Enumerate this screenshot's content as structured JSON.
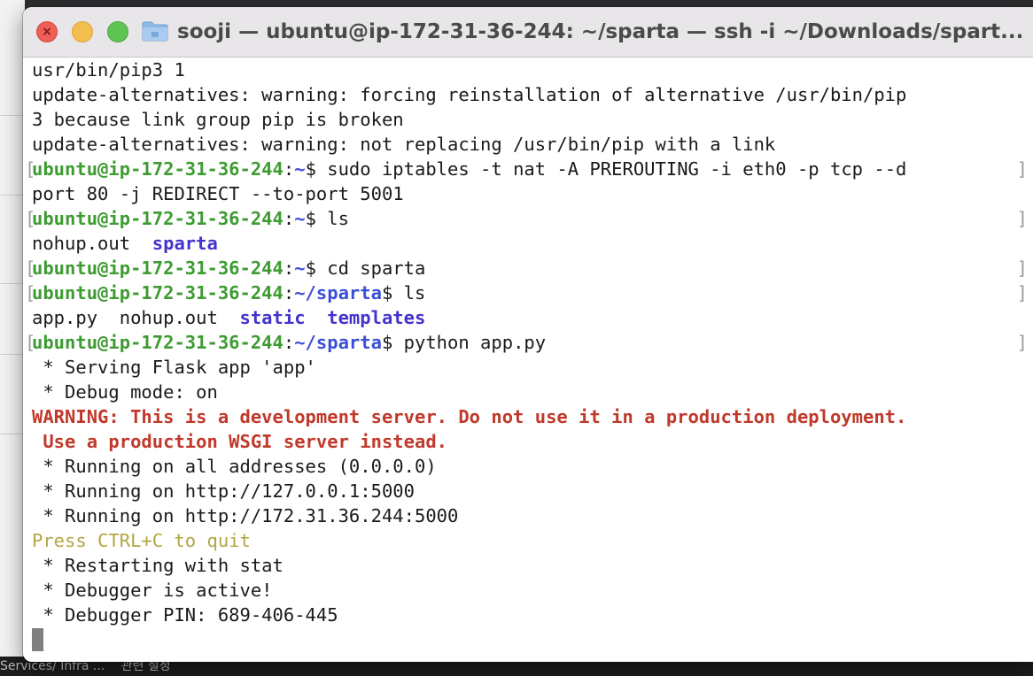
{
  "window": {
    "title": "sooji — ubuntu@ip-172-31-36-244: ~/sparta — ssh -i ~/Downloads/spart..."
  },
  "background": {
    "bottom_text": "Services/ Infra  ... 　관련 설정"
  },
  "terminal": {
    "user_host": "ubuntu@ip-172-31-36-244",
    "lines": {
      "l1": "usr/bin/pip3 1",
      "l2": "update-alternatives: warning: forcing reinstallation of alternative /usr/bin/pip",
      "l3": "3 because link group pip is broken",
      "l4": "update-alternatives: warning: not replacing /usr/bin/pip with a link",
      "l5_cmd": " sudo iptables -t nat -A PREROUTING -i eth0 -p tcp --d",
      "l6": "port 80 -j REDIRECT --to-port 5001",
      "l7_cmd": " ls",
      "l8a": "nohup.out  ",
      "l8b": "sparta",
      "l9_cmd": " cd sparta",
      "l10_cmd": " ls",
      "l11a": "app.py  nohup.out  ",
      "l11b": "static",
      "l11c": "templates",
      "l12_cmd": " python app.py",
      "l13": " * Serving Flask app 'app'",
      "l14": " * Debug mode: on",
      "l15": "WARNING: This is a development server. Do not use it in a production deployment.",
      "l16": " Use a production WSGI server instead.",
      "l17": " * Running on all addresses (0.0.0.0)",
      "l18": " * Running on http://127.0.0.1:5000",
      "l19": " * Running on http://172.31.36.244:5000",
      "l20": "Press CTRL+C to quit",
      "l21": " * Restarting with stat",
      "l22": " * Debugger is active!",
      "l23": " * Debugger PIN: 689-406-445"
    },
    "path_home": "~",
    "path_sparta": "~/sparta",
    "colon": ":",
    "dollar": "$",
    "bracket_l": "[",
    "bracket_r": "]"
  },
  "colors": {
    "user": "#3e9b32",
    "path": "#3a4fd6",
    "warning": "#c0392b",
    "quit": "#b3a644",
    "close": "#ed5f57",
    "minimize": "#f4be4f",
    "maximize": "#5fc454"
  }
}
